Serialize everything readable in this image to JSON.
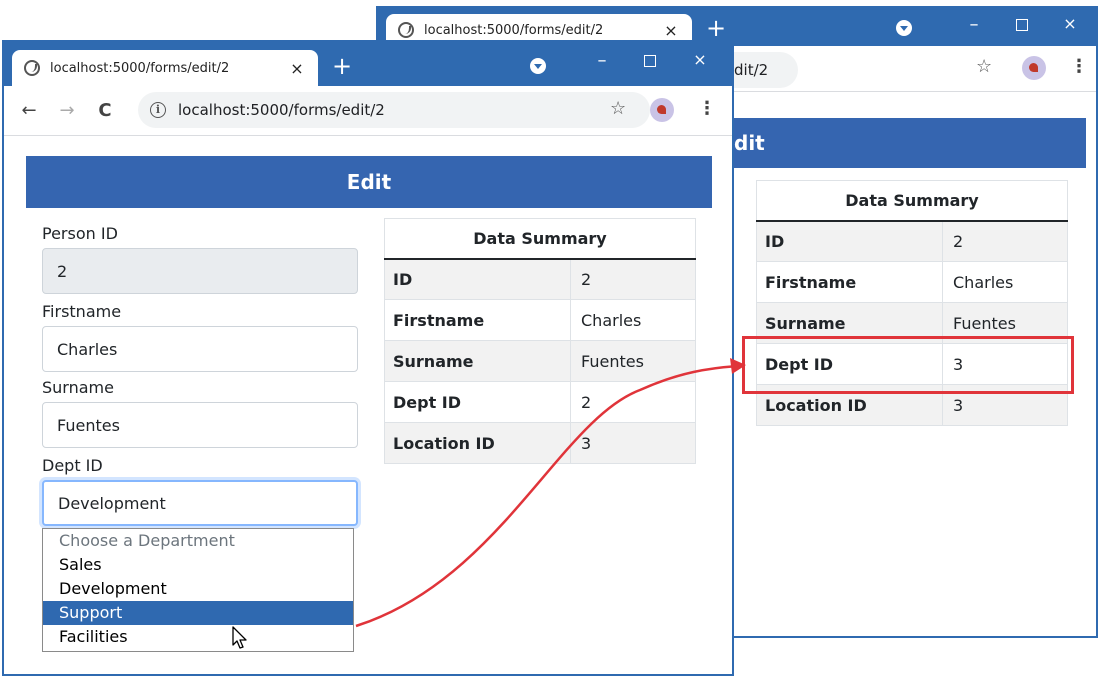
{
  "back_window": {
    "tab_title": "localhost:5000/forms/edit/2",
    "tab_close": "×",
    "new_tab": "+",
    "url_partial": "dit/2",
    "header": "dit",
    "table": {
      "title": "Data Summary",
      "rows": [
        {
          "key": "ID",
          "value": "2"
        },
        {
          "key": "Firstname",
          "value": "Charles"
        },
        {
          "key": "Surname",
          "value": "Fuentes"
        },
        {
          "key": "Dept ID",
          "value": "3"
        },
        {
          "key": "Location ID",
          "value": "3"
        }
      ]
    }
  },
  "front_window": {
    "tab_title": "localhost:5000/forms/edit/2",
    "tab_close": "×",
    "new_tab": "+",
    "url": "localhost:5000/forms/edit/2",
    "header": "Edit",
    "form": {
      "person_id_label": "Person ID",
      "person_id_value": "2",
      "firstname_label": "Firstname",
      "firstname_value": "Charles",
      "surname_label": "Surname",
      "surname_value": "Fuentes",
      "dept_label": "Dept ID",
      "dept_value": "Development",
      "dept_options": [
        "Choose a Department",
        "Sales",
        "Development",
        "Support",
        "Facilities"
      ],
      "dept_highlighted": "Support"
    },
    "table": {
      "title": "Data Summary",
      "rows": [
        {
          "key": "ID",
          "value": "2"
        },
        {
          "key": "Firstname",
          "value": "Charles"
        },
        {
          "key": "Surname",
          "value": "Fuentes"
        },
        {
          "key": "Dept ID",
          "value": "2"
        },
        {
          "key": "Location ID",
          "value": "3"
        }
      ]
    }
  },
  "window_controls": {
    "minimize": "–",
    "close": "×"
  },
  "toolbar_glyphs": {
    "back": "←",
    "forward": "→",
    "reload": "C",
    "info": "i",
    "star": "☆",
    "menu": "⋮"
  },
  "colors": {
    "accent": "#2f6ab0",
    "header": "#3565b0",
    "highlight": "#e0343a",
    "selected_option": "#2f69b0"
  },
  "icons": [
    "globe-icon",
    "close-icon",
    "plus-icon",
    "profile-icon",
    "minimize-icon",
    "maximize-icon",
    "back-arrow-icon",
    "forward-arrow-icon",
    "reload-icon",
    "info-icon",
    "star-icon",
    "extension-icon",
    "menu-icon",
    "cursor-icon",
    "annotation-arrow"
  ]
}
